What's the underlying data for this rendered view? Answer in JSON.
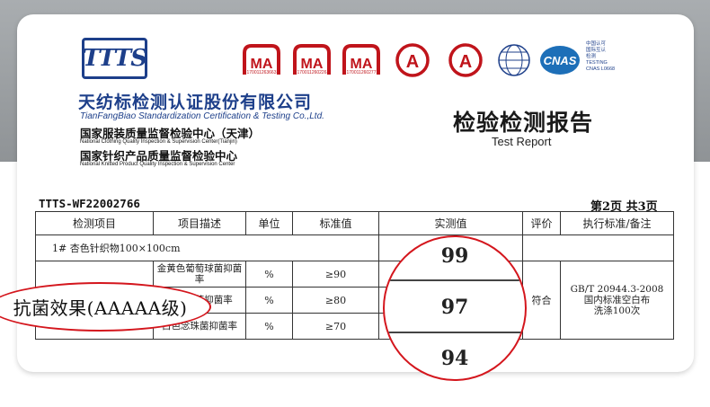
{
  "header": {
    "logo_text": "TTTS",
    "company_cn": "天纺标检测认证股份有限公司",
    "company_en": "TianFangBiao Standardization Certification & Testing Co.,Ltd.",
    "center1_cn": "国家服装质量监督检验中心（天津）",
    "center1_en": "National Clothing Quality Inspection & Supervision Center(Tianjin)",
    "center2_cn": "国家针织产品质量监督检验中心",
    "center2_en": "National Knitted Product Quality Inspection & Supervision Center"
  },
  "certs": {
    "ma1_code": "170011263663",
    "ma2_code": "170011260226",
    "ma3_code": "170011260277",
    "cnas_line1": "中国认可",
    "cnas_line2": "国际互认",
    "cnas_line3": "检测",
    "cnas_line4": "TESTING",
    "cnas_line5": "CNAS L0668",
    "cnas": "CNAS",
    "ma": "MA",
    "cal": "A"
  },
  "report": {
    "title_cn": "检验检测报告",
    "title_en": "Test Report",
    "number": "TTTS-WF22002766",
    "page": "第2页  共3页"
  },
  "table": {
    "headers": [
      "检测项目",
      "项目描述",
      "单位",
      "标准值",
      "实测值",
      "评价",
      "执行标准/备注"
    ],
    "sample": "1#     杏色针织物100×100cm",
    "rows": [
      {
        "desc": "金黄色葡萄球菌抑菌率",
        "unit": "%",
        "standard": "≥90",
        "measured": "99"
      },
      {
        "desc": "大肠杆菌抑菌率",
        "unit": "%",
        "standard": "≥80",
        "measured": "97"
      },
      {
        "desc": "白色念珠菌抑菌率",
        "unit": "%",
        "standard": "≥70",
        "measured": "94"
      }
    ],
    "evaluation": "符合",
    "standard_note_1": "GB/T 20944.3-2008",
    "standard_note_2": "国内标准空白布",
    "standard_note_3": "洗涤100次"
  },
  "overlay": {
    "label": "抗菌效果(AAAAA级)",
    "magnified": [
      "99",
      "97",
      "94"
    ]
  },
  "colors": {
    "brand_blue": "#1d3f8a",
    "seal_red": "#c0141b",
    "highlight_red": "#d4161d"
  }
}
